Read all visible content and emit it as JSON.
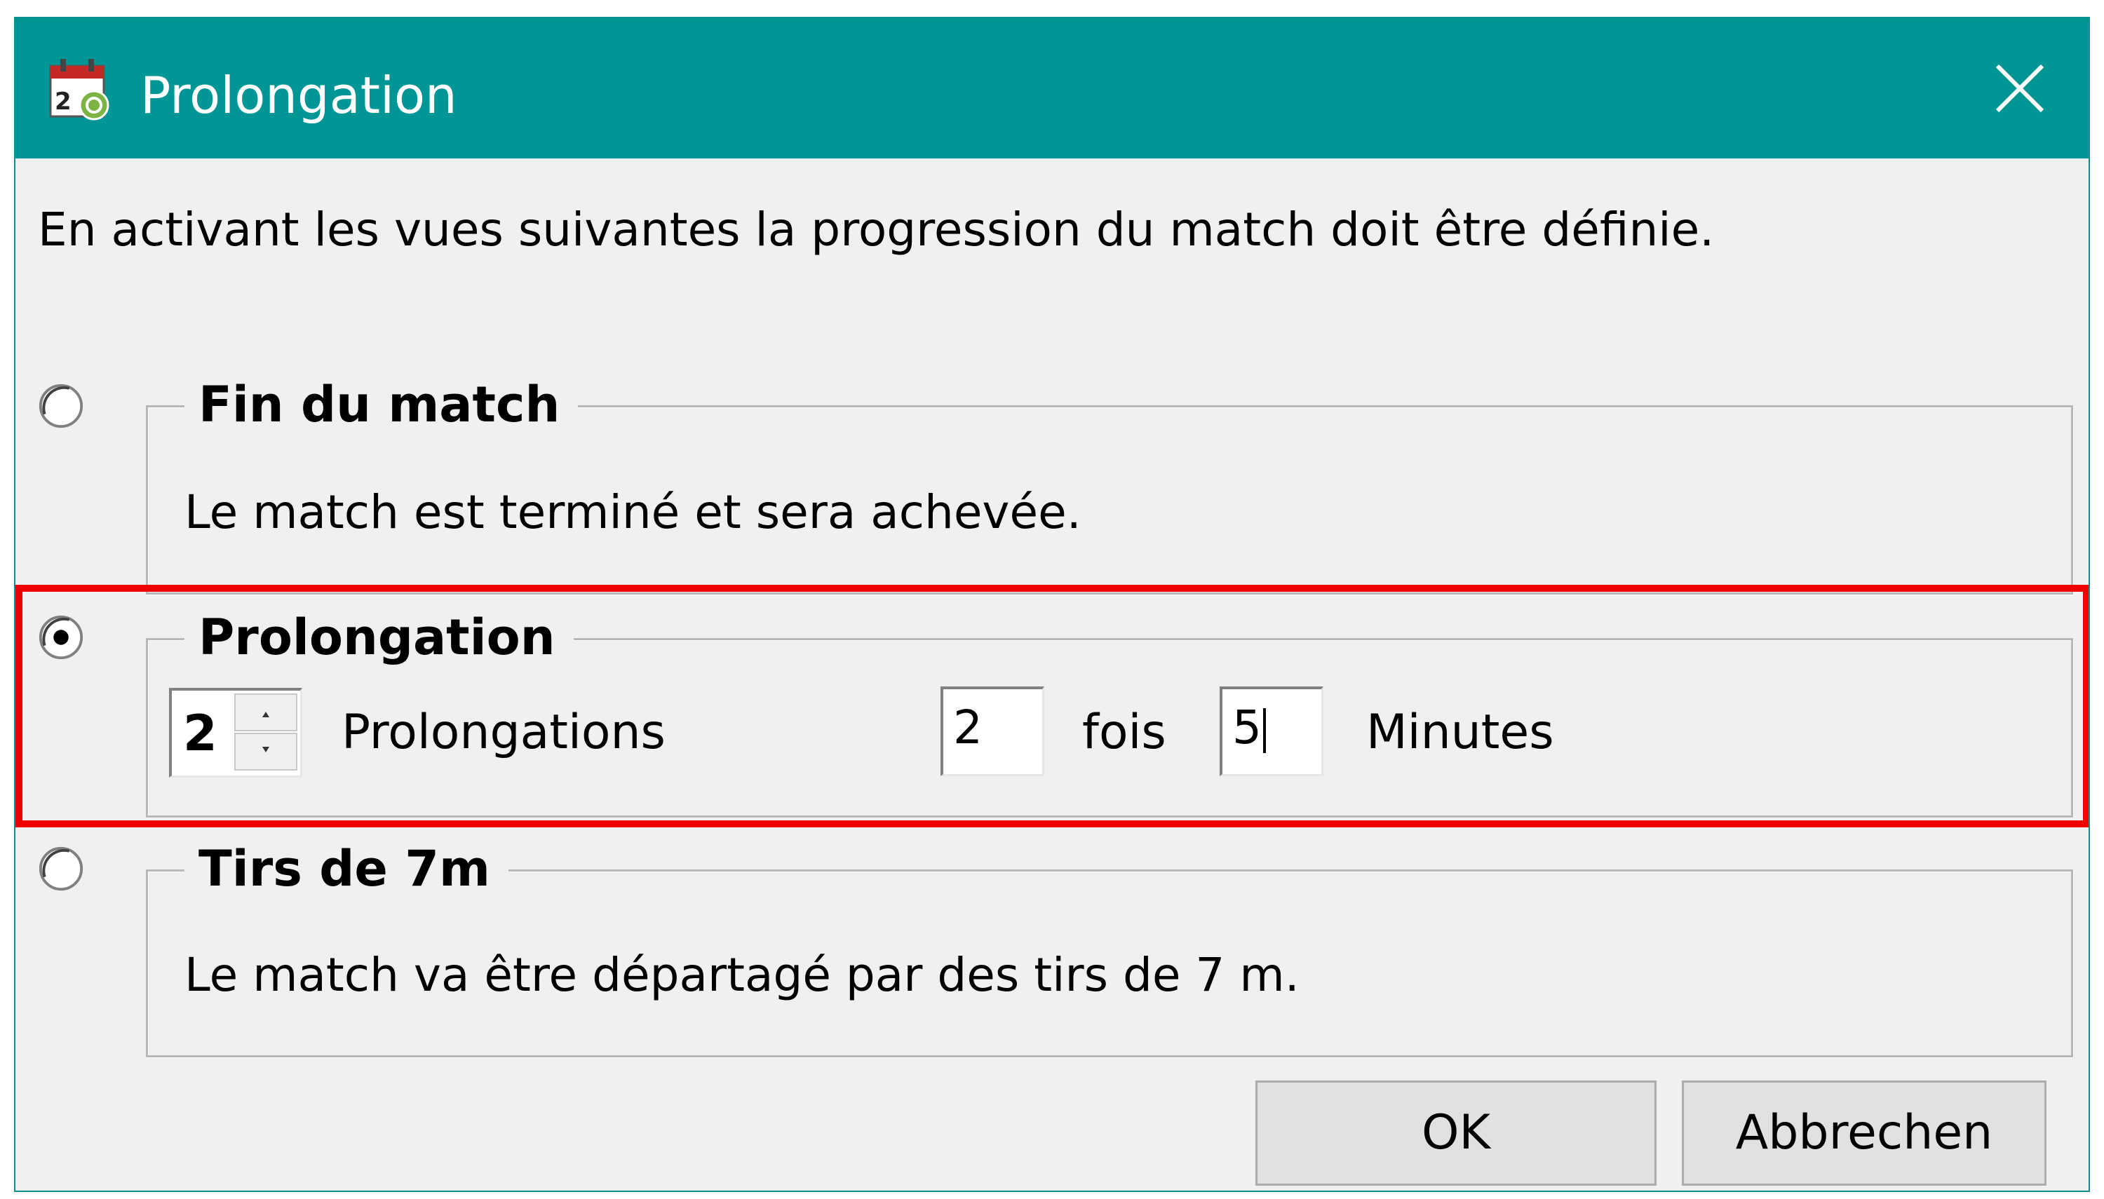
{
  "window": {
    "title": "Prolongation",
    "app_icon_date": "20"
  },
  "intro_text": "En activant les vues suivantes la progression du match doit être définie.",
  "options": {
    "end": {
      "label": "Fin du match",
      "description": "Le match est terminé et sera achevée.",
      "selected": false
    },
    "prolongation": {
      "label": "Prolongation",
      "selected": true,
      "count_value": "2",
      "count_label": "Prolongations",
      "times_value": "2",
      "times_label": "fois",
      "minutes_value": "5",
      "minutes_label": "Minutes"
    },
    "penalties": {
      "label": "Tirs de 7m",
      "description": "Le match va être départagé par des tirs de 7 m.",
      "selected": false
    }
  },
  "buttons": {
    "ok_label": "OK",
    "cancel_label": "Abbrechen"
  },
  "colors": {
    "titlebar": "#009696",
    "highlight": "#ee0000",
    "dialog_bg": "#f0f0f0"
  }
}
